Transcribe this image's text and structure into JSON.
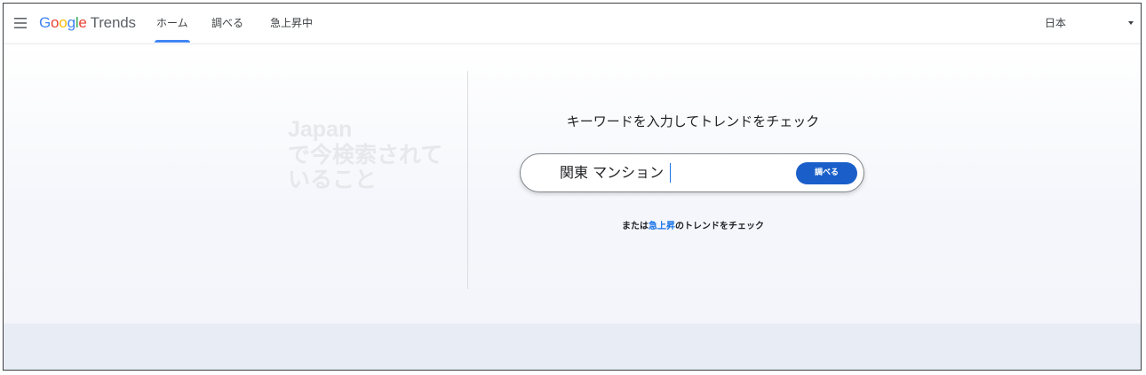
{
  "header": {
    "logo": {
      "letters": [
        "G",
        "o",
        "o",
        "g",
        "l",
        "e"
      ],
      "product": "Trends"
    },
    "tabs": [
      {
        "label": "ホーム",
        "active": true
      },
      {
        "label": "調べる",
        "active": false
      },
      {
        "label": "急上昇中",
        "active": false
      }
    ],
    "region": "日本"
  },
  "hero": {
    "line1": "Japan",
    "line2": "で今検索されて",
    "line3": "いること",
    "prompt": "キーワードを入力してトレンドをチェック",
    "search_value": "関東 マンション",
    "explore_label": "調べる",
    "or_prefix": "または",
    "or_link": "急上昇",
    "or_suffix": "のトレンドをチェック"
  },
  "colors": {
    "accent": "#4285f4",
    "button": "#1a5fc9",
    "link": "#1a73e8"
  },
  "icons": {
    "menu": "menu-icon",
    "dropdown": "chevron-down-icon"
  }
}
